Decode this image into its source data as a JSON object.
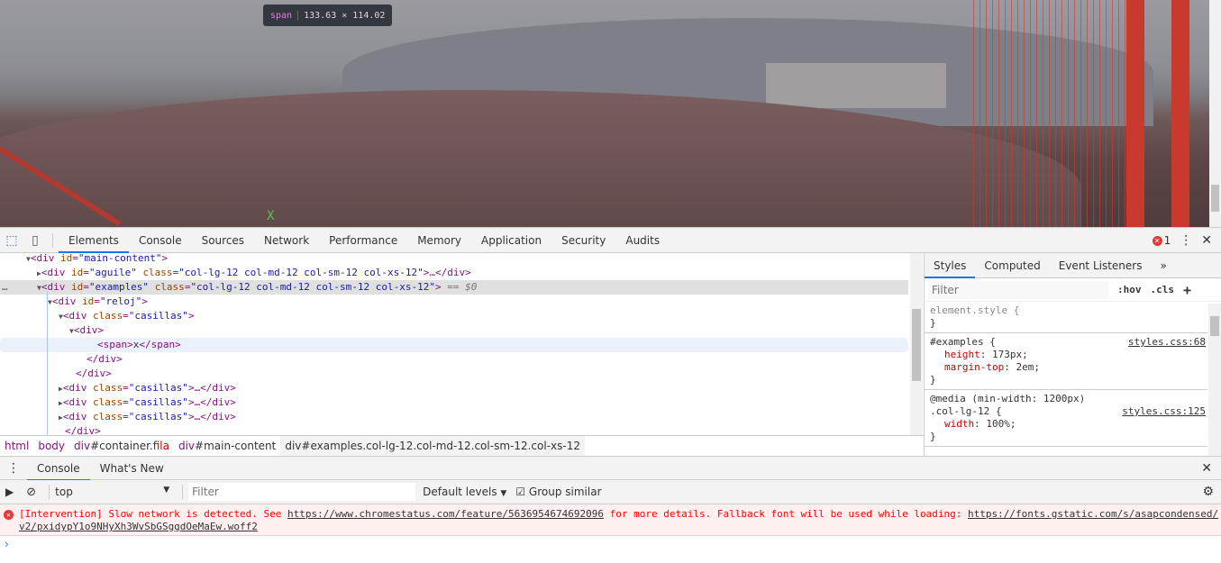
{
  "page": {
    "tooltip": {
      "tag": "span",
      "size": "133.63 × 114.02"
    },
    "text_x": "X"
  },
  "toolbar": {
    "tabs": [
      "Elements",
      "Console",
      "Sources",
      "Network",
      "Performance",
      "Memory",
      "Application",
      "Security",
      "Audits"
    ],
    "active_tab": "Elements",
    "error_count": "1"
  },
  "elements": {
    "dots": "…",
    "lines": [
      {
        "tag": "div",
        "id": "main-content"
      },
      {
        "tag": "div",
        "id": "aguile",
        "class": "col-lg-12 col-md-12 col-sm-12 col-xs-12",
        "collapsed": "…</div>"
      },
      {
        "tag": "div",
        "id": "examples",
        "class": "col-lg-12 col-md-12 col-sm-12 col-xs-12",
        "suffix": "== $0"
      },
      {
        "tag": "div",
        "id": "reloj"
      },
      {
        "tag": "div",
        "class": "casillas"
      },
      {
        "tag": "div"
      },
      {
        "text": "<span>x</span>"
      },
      {
        "text": "</div>"
      },
      {
        "text": "</div>"
      },
      {
        "tag": "div",
        "class": "casillas",
        "collapsed": "…</div>"
      },
      {
        "tag": "div",
        "class": "casillas",
        "collapsed": "…</div>"
      },
      {
        "tag": "div",
        "class": "casillas",
        "collapsed": "…</div>"
      },
      {
        "text": "</div>"
      }
    ]
  },
  "breadcrumbs": [
    "html",
    "body",
    "div#container.fila",
    "div#main-content",
    "div#examples.col-lg-12.col-md-12.col-sm-12.col-xs-12"
  ],
  "styles": {
    "tabs": [
      "Styles",
      "Computed",
      "Event Listeners",
      "»"
    ],
    "filter_placeholder": "Filter",
    "hov": ":hov",
    "cls": ".cls",
    "add": "+",
    "rules": [
      {
        "selector": "element.style {",
        "props": []
      },
      {
        "selector": "#examples {",
        "source": "styles.css:68",
        "props": [
          {
            "name": "height",
            "value": "173px;"
          },
          {
            "name": "margin-top",
            "value": "2em;"
          }
        ]
      },
      {
        "media": "@media (min-width: 1200px)",
        "selector": ".col-lg-12 {",
        "source": "styles.css:125",
        "props": [
          {
            "name": "width",
            "value": "100%;"
          }
        ]
      }
    ]
  },
  "drawer": {
    "tabs": [
      "Console",
      "What's New"
    ],
    "context": "top",
    "filter_placeholder": "Filter",
    "levels": "Default levels",
    "group_similar": "Group similar",
    "group_similar_checked": true
  },
  "console": {
    "message": {
      "text1": "[Intervention] Slow network is detected. See ",
      "link1": "https://www.chromestatus.com/feature/5636954674692096",
      "text2": " for more details. Fallback font will be used while loading: ",
      "link2": "https://fonts.gstatic.com/s/asapcondensed/v2/pxidypY1o9NHyXh3WvSbGSggdOeMaEw.woff2"
    },
    "prompt": "›"
  },
  "colors": {
    "accent": "#1a73e8",
    "tag": "#881280",
    "attr_name": "#994500",
    "attr_value": "#1a1aa6",
    "error": "#ff0000"
  }
}
